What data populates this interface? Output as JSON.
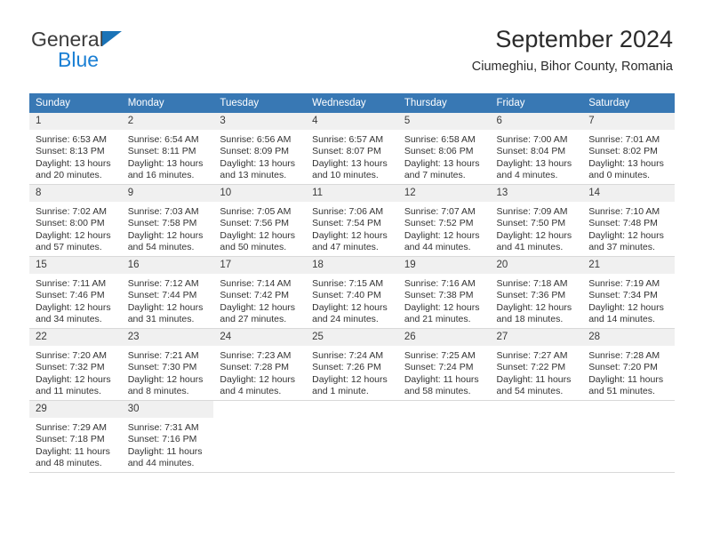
{
  "brand": {
    "name_part1": "General",
    "name_part2": "Blue",
    "accent_color": "#1a7fd4",
    "logo_triangle_color": "#1a73b7"
  },
  "header": {
    "title": "September 2024",
    "subtitle": "Ciumeghiu, Bihor County, Romania"
  },
  "theme": {
    "header_row_bg": "#3878b4",
    "header_row_text": "#ffffff",
    "daynum_bg": "#f0f0f0",
    "cell_border": "#d9d9d9"
  },
  "weekday_headers": [
    "Sunday",
    "Monday",
    "Tuesday",
    "Wednesday",
    "Thursday",
    "Friday",
    "Saturday"
  ],
  "labels": {
    "sunrise_prefix": "Sunrise:",
    "sunset_prefix": "Sunset:",
    "daylight_prefix": "Daylight:"
  },
  "weeks": [
    [
      {
        "day": "1",
        "sunrise": "Sunrise: 6:53 AM",
        "sunset": "Sunset: 8:13 PM",
        "daylight_line1": "Daylight: 13 hours",
        "daylight_line2": "and 20 minutes."
      },
      {
        "day": "2",
        "sunrise": "Sunrise: 6:54 AM",
        "sunset": "Sunset: 8:11 PM",
        "daylight_line1": "Daylight: 13 hours",
        "daylight_line2": "and 16 minutes."
      },
      {
        "day": "3",
        "sunrise": "Sunrise: 6:56 AM",
        "sunset": "Sunset: 8:09 PM",
        "daylight_line1": "Daylight: 13 hours",
        "daylight_line2": "and 13 minutes."
      },
      {
        "day": "4",
        "sunrise": "Sunrise: 6:57 AM",
        "sunset": "Sunset: 8:07 PM",
        "daylight_line1": "Daylight: 13 hours",
        "daylight_line2": "and 10 minutes."
      },
      {
        "day": "5",
        "sunrise": "Sunrise: 6:58 AM",
        "sunset": "Sunset: 8:06 PM",
        "daylight_line1": "Daylight: 13 hours",
        "daylight_line2": "and 7 minutes."
      },
      {
        "day": "6",
        "sunrise": "Sunrise: 7:00 AM",
        "sunset": "Sunset: 8:04 PM",
        "daylight_line1": "Daylight: 13 hours",
        "daylight_line2": "and 4 minutes."
      },
      {
        "day": "7",
        "sunrise": "Sunrise: 7:01 AM",
        "sunset": "Sunset: 8:02 PM",
        "daylight_line1": "Daylight: 13 hours",
        "daylight_line2": "and 0 minutes."
      }
    ],
    [
      {
        "day": "8",
        "sunrise": "Sunrise: 7:02 AM",
        "sunset": "Sunset: 8:00 PM",
        "daylight_line1": "Daylight: 12 hours",
        "daylight_line2": "and 57 minutes."
      },
      {
        "day": "9",
        "sunrise": "Sunrise: 7:03 AM",
        "sunset": "Sunset: 7:58 PM",
        "daylight_line1": "Daylight: 12 hours",
        "daylight_line2": "and 54 minutes."
      },
      {
        "day": "10",
        "sunrise": "Sunrise: 7:05 AM",
        "sunset": "Sunset: 7:56 PM",
        "daylight_line1": "Daylight: 12 hours",
        "daylight_line2": "and 50 minutes."
      },
      {
        "day": "11",
        "sunrise": "Sunrise: 7:06 AM",
        "sunset": "Sunset: 7:54 PM",
        "daylight_line1": "Daylight: 12 hours",
        "daylight_line2": "and 47 minutes."
      },
      {
        "day": "12",
        "sunrise": "Sunrise: 7:07 AM",
        "sunset": "Sunset: 7:52 PM",
        "daylight_line1": "Daylight: 12 hours",
        "daylight_line2": "and 44 minutes."
      },
      {
        "day": "13",
        "sunrise": "Sunrise: 7:09 AM",
        "sunset": "Sunset: 7:50 PM",
        "daylight_line1": "Daylight: 12 hours",
        "daylight_line2": "and 41 minutes."
      },
      {
        "day": "14",
        "sunrise": "Sunrise: 7:10 AM",
        "sunset": "Sunset: 7:48 PM",
        "daylight_line1": "Daylight: 12 hours",
        "daylight_line2": "and 37 minutes."
      }
    ],
    [
      {
        "day": "15",
        "sunrise": "Sunrise: 7:11 AM",
        "sunset": "Sunset: 7:46 PM",
        "daylight_line1": "Daylight: 12 hours",
        "daylight_line2": "and 34 minutes."
      },
      {
        "day": "16",
        "sunrise": "Sunrise: 7:12 AM",
        "sunset": "Sunset: 7:44 PM",
        "daylight_line1": "Daylight: 12 hours",
        "daylight_line2": "and 31 minutes."
      },
      {
        "day": "17",
        "sunrise": "Sunrise: 7:14 AM",
        "sunset": "Sunset: 7:42 PM",
        "daylight_line1": "Daylight: 12 hours",
        "daylight_line2": "and 27 minutes."
      },
      {
        "day": "18",
        "sunrise": "Sunrise: 7:15 AM",
        "sunset": "Sunset: 7:40 PM",
        "daylight_line1": "Daylight: 12 hours",
        "daylight_line2": "and 24 minutes."
      },
      {
        "day": "19",
        "sunrise": "Sunrise: 7:16 AM",
        "sunset": "Sunset: 7:38 PM",
        "daylight_line1": "Daylight: 12 hours",
        "daylight_line2": "and 21 minutes."
      },
      {
        "day": "20",
        "sunrise": "Sunrise: 7:18 AM",
        "sunset": "Sunset: 7:36 PM",
        "daylight_line1": "Daylight: 12 hours",
        "daylight_line2": "and 18 minutes."
      },
      {
        "day": "21",
        "sunrise": "Sunrise: 7:19 AM",
        "sunset": "Sunset: 7:34 PM",
        "daylight_line1": "Daylight: 12 hours",
        "daylight_line2": "and 14 minutes."
      }
    ],
    [
      {
        "day": "22",
        "sunrise": "Sunrise: 7:20 AM",
        "sunset": "Sunset: 7:32 PM",
        "daylight_line1": "Daylight: 12 hours",
        "daylight_line2": "and 11 minutes."
      },
      {
        "day": "23",
        "sunrise": "Sunrise: 7:21 AM",
        "sunset": "Sunset: 7:30 PM",
        "daylight_line1": "Daylight: 12 hours",
        "daylight_line2": "and 8 minutes."
      },
      {
        "day": "24",
        "sunrise": "Sunrise: 7:23 AM",
        "sunset": "Sunset: 7:28 PM",
        "daylight_line1": "Daylight: 12 hours",
        "daylight_line2": "and 4 minutes."
      },
      {
        "day": "25",
        "sunrise": "Sunrise: 7:24 AM",
        "sunset": "Sunset: 7:26 PM",
        "daylight_line1": "Daylight: 12 hours",
        "daylight_line2": "and 1 minute."
      },
      {
        "day": "26",
        "sunrise": "Sunrise: 7:25 AM",
        "sunset": "Sunset: 7:24 PM",
        "daylight_line1": "Daylight: 11 hours",
        "daylight_line2": "and 58 minutes."
      },
      {
        "day": "27",
        "sunrise": "Sunrise: 7:27 AM",
        "sunset": "Sunset: 7:22 PM",
        "daylight_line1": "Daylight: 11 hours",
        "daylight_line2": "and 54 minutes."
      },
      {
        "day": "28",
        "sunrise": "Sunrise: 7:28 AM",
        "sunset": "Sunset: 7:20 PM",
        "daylight_line1": "Daylight: 11 hours",
        "daylight_line2": "and 51 minutes."
      }
    ],
    [
      {
        "day": "29",
        "sunrise": "Sunrise: 7:29 AM",
        "sunset": "Sunset: 7:18 PM",
        "daylight_line1": "Daylight: 11 hours",
        "daylight_line2": "and 48 minutes."
      },
      {
        "day": "30",
        "sunrise": "Sunrise: 7:31 AM",
        "sunset": "Sunset: 7:16 PM",
        "daylight_line1": "Daylight: 11 hours",
        "daylight_line2": "and 44 minutes."
      },
      null,
      null,
      null,
      null,
      null
    ]
  ]
}
